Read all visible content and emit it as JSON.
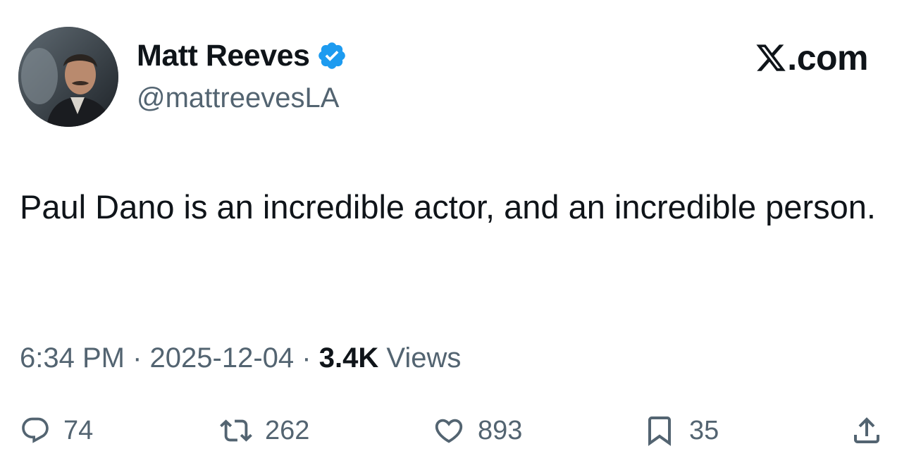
{
  "author": {
    "display_name": "Matt Reeves",
    "handle": "@mattreevesLA",
    "verified": true,
    "verified_color": "#1d9bf0"
  },
  "brand": {
    "label": ".com",
    "icon": "x-logo-icon"
  },
  "tweet": {
    "text": "Paul Dano is an incredible actor, and an incredible person.",
    "time": "6:34 PM",
    "date": "2025-12-04",
    "separator": "·",
    "views_count": "3.4K",
    "views_label": "Views"
  },
  "actions": {
    "reply": {
      "icon": "reply-icon",
      "count": "74"
    },
    "retweet": {
      "icon": "retweet-icon",
      "count": "262"
    },
    "like": {
      "icon": "heart-icon",
      "count": "893"
    },
    "bookmark": {
      "icon": "bookmark-icon",
      "count": "35"
    },
    "share": {
      "icon": "share-icon"
    }
  },
  "colors": {
    "text_primary": "#0f1419",
    "text_secondary": "#536471"
  }
}
